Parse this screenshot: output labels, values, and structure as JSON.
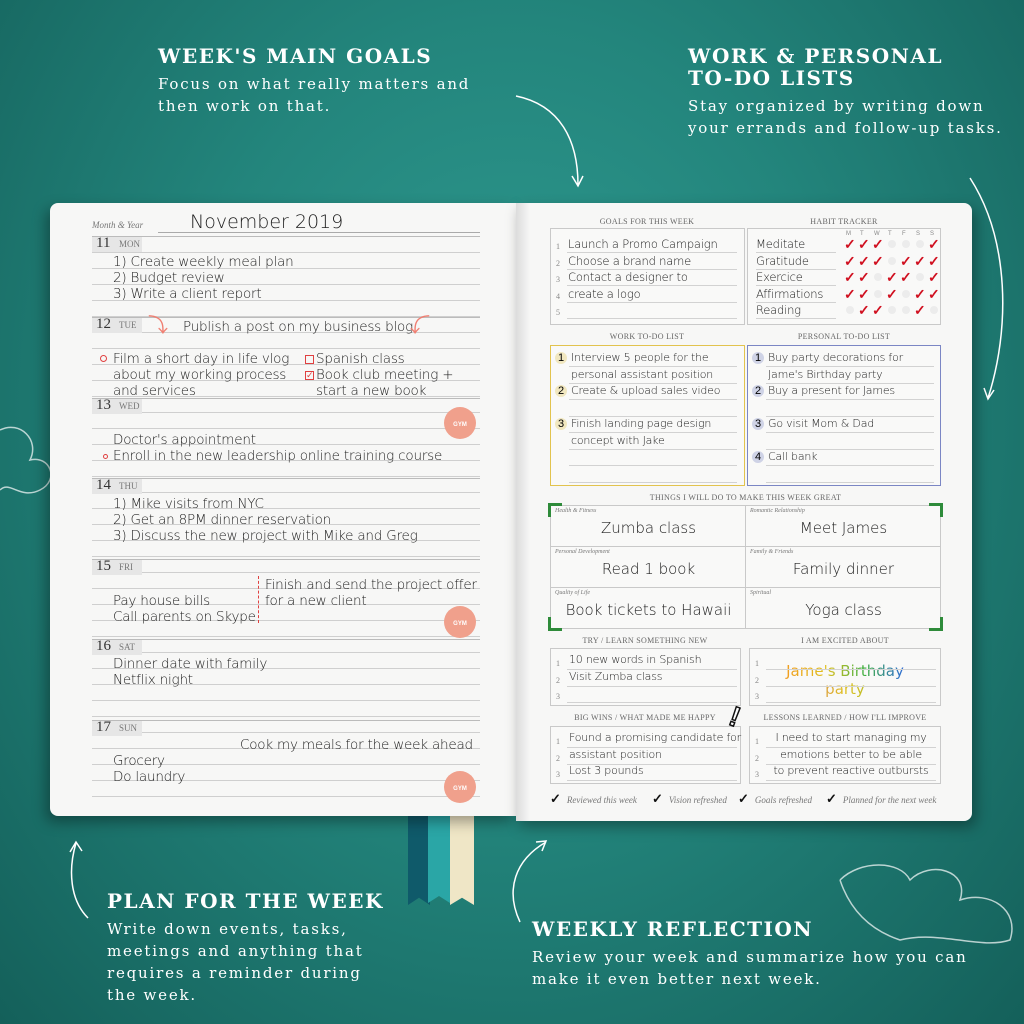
{
  "captions": {
    "main_goals": {
      "title": "WEEK'S MAIN GOALS",
      "desc": "Focus on what really matters and then work on that."
    },
    "todo": {
      "title1": "WORK & PERSONAL",
      "title2": "TO-DO LISTS",
      "desc": "Stay organized by writing down your errands and follow-up tasks."
    },
    "plan": {
      "title": "PLAN FOR THE WEEK",
      "desc": "Write down events, tasks, meetings and anything that requires a reminder during the week."
    },
    "reflection": {
      "title": "WEEKLY REFLECTION",
      "desc": "Review your week and summarize how you can make it even better next week."
    }
  },
  "left": {
    "month_label": "Month & Year",
    "month_value": "November 2019",
    "gym_label": "GYM",
    "days": [
      {
        "n": "11",
        "w": "MON"
      },
      {
        "n": "12",
        "w": "TUE"
      },
      {
        "n": "13",
        "w": "WED"
      },
      {
        "n": "14",
        "w": "THU"
      },
      {
        "n": "15",
        "w": "FRI"
      },
      {
        "n": "16",
        "w": "SAT"
      },
      {
        "n": "17",
        "w": "SUN"
      }
    ],
    "mon": [
      "1) Create weekly meal plan",
      "2) Budget review",
      "3) Write a client report"
    ],
    "tue": {
      "headline": "Publish a post on my business blog",
      "left": [
        "Film a short day in life vlog",
        "about my working process",
        "and services"
      ],
      "right": [
        "Spanish class",
        "Book club meeting +",
        "start a new book"
      ],
      "right_checked": [
        false,
        true
      ]
    },
    "wed": [
      "Doctor's appointment",
      "Enroll in the new leadership online training course"
    ],
    "thu": [
      "1) Mike visits from NYC",
      "2) Get an 8PM dinner reservation",
      "3) Discuss the new project with Mike and Greg"
    ],
    "fri": {
      "left": [
        "Pay house bills",
        "Call parents on Skype"
      ],
      "right": [
        "Finish and send the project offer",
        "for a new client"
      ]
    },
    "sat": [
      "Dinner date with family",
      "Netflix night"
    ],
    "sun": {
      "right": "Cook my meals for the week ahead",
      "left": [
        "Grocery",
        "Do laundry"
      ]
    }
  },
  "right": {
    "goals": {
      "title": "GOALS FOR THIS WEEK",
      "numbers": [
        "1",
        "2",
        "3",
        "4",
        "5"
      ],
      "items": [
        "Launch a Promo Campaign",
        "Choose a brand name",
        "Contact a designer to",
        "create a logo",
        ""
      ]
    },
    "habits": {
      "title": "HABIT TRACKER",
      "days": [
        "M",
        "T",
        "W",
        "T",
        "F",
        "S",
        "S"
      ],
      "rows": [
        {
          "name": "Meditate",
          "done": [
            1,
            1,
            1,
            0,
            0,
            0,
            1
          ]
        },
        {
          "name": "Gratitude",
          "done": [
            1,
            1,
            1,
            0,
            1,
            1,
            1
          ]
        },
        {
          "name": "Exercice",
          "done": [
            1,
            1,
            0,
            1,
            1,
            0,
            1
          ]
        },
        {
          "name": "Affirmations",
          "done": [
            1,
            1,
            0,
            1,
            0,
            1,
            1
          ]
        },
        {
          "name": "Reading",
          "done": [
            0,
            1,
            1,
            0,
            0,
            1,
            0
          ]
        }
      ],
      "check_color": "#d01020"
    },
    "work": {
      "title": "WORK TO-DO LIST",
      "accent": "#e2c34e",
      "items": [
        {
          "n": "1",
          "lines": [
            "Interview 5 people for the",
            "personal assistant position"
          ]
        },
        {
          "n": "2",
          "lines": [
            "Create & upload sales video"
          ]
        },
        {
          "n": "3",
          "lines": [
            "Finish landing page design",
            "concept with Jake"
          ]
        }
      ]
    },
    "personal": {
      "title": "PERSONAL TO-DO LIST",
      "accent": "#7b86c4",
      "items": [
        {
          "n": "1",
          "lines": [
            "Buy party decorations for",
            "Jame's Birthday party"
          ]
        },
        {
          "n": "2",
          "lines": [
            "Buy a present for James"
          ]
        },
        {
          "n": "3",
          "lines": [
            "Go visit Mom & Dad"
          ]
        },
        {
          "n": "4",
          "lines": [
            "Call bank"
          ]
        }
      ]
    },
    "great": {
      "title": "THINGS I WILL DO TO MAKE THIS WEEK GREAT",
      "cells": [
        {
          "label": "Health & Fitness",
          "value": "Zumba class"
        },
        {
          "label": "Romantic Relationship",
          "value": "Meet James"
        },
        {
          "label": "Personal Development",
          "value": "Read 1 book"
        },
        {
          "label": "Family & Friends",
          "value": "Family dinner"
        },
        {
          "label": "Quality of Life",
          "value": "Book tickets to Hawaii"
        },
        {
          "label": "Spiritual",
          "value": "Yoga class"
        }
      ],
      "bracket_color": "#2e8b3a"
    },
    "try": {
      "title": "TRY / LEARN SOMETHING NEW",
      "items": [
        "10 new words in Spanish",
        "Visit Zumba class",
        ""
      ]
    },
    "excited": {
      "title": "I AM EXCITED ABOUT",
      "line1": "Jame's Birthday",
      "line2": "party"
    },
    "wins": {
      "title": "BIG WINS / WHAT MADE ME HAPPY",
      "items": [
        "Found a promising candidate for",
        "assistant position",
        "Lost 3 pounds"
      ]
    },
    "lessons": {
      "title": "LESSONS LEARNED / HOW I'LL IMPROVE",
      "items": [
        "I need to start managing my",
        "emotions better to be able",
        "to prevent reactive outbursts"
      ]
    },
    "footer": [
      "Reviewed this week",
      "Vision refreshed",
      "Goals refreshed",
      "Planned for the next week"
    ]
  }
}
